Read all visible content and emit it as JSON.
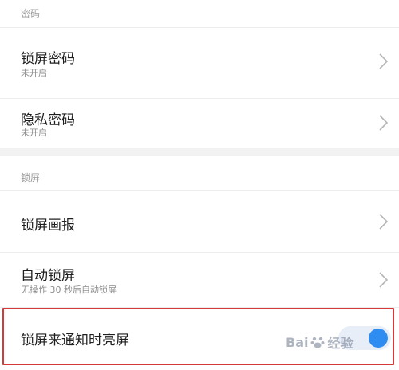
{
  "sections": {
    "password": {
      "header": "密码",
      "lock_screen_password": {
        "title": "锁屏密码",
        "status": "未开启"
      },
      "privacy_password": {
        "title": "隐私密码",
        "status": "未开启"
      }
    },
    "lock_screen": {
      "header": "锁屏",
      "lock_screen_wallpaper": {
        "title": "锁屏画报"
      },
      "auto_lock": {
        "title": "自动锁屏",
        "subtitle": "无操作 30 秒后自动锁屏"
      },
      "wake_on_notification": {
        "title": "锁屏来通知时亮屏",
        "enabled": true
      }
    }
  },
  "icons": {
    "chevron": "chevron-right-icon"
  },
  "colors": {
    "toggle_on": "#2f8cf0",
    "highlight_border": "#d43a3a"
  },
  "watermark": {
    "text": "Bai",
    "suffix": "经验"
  }
}
